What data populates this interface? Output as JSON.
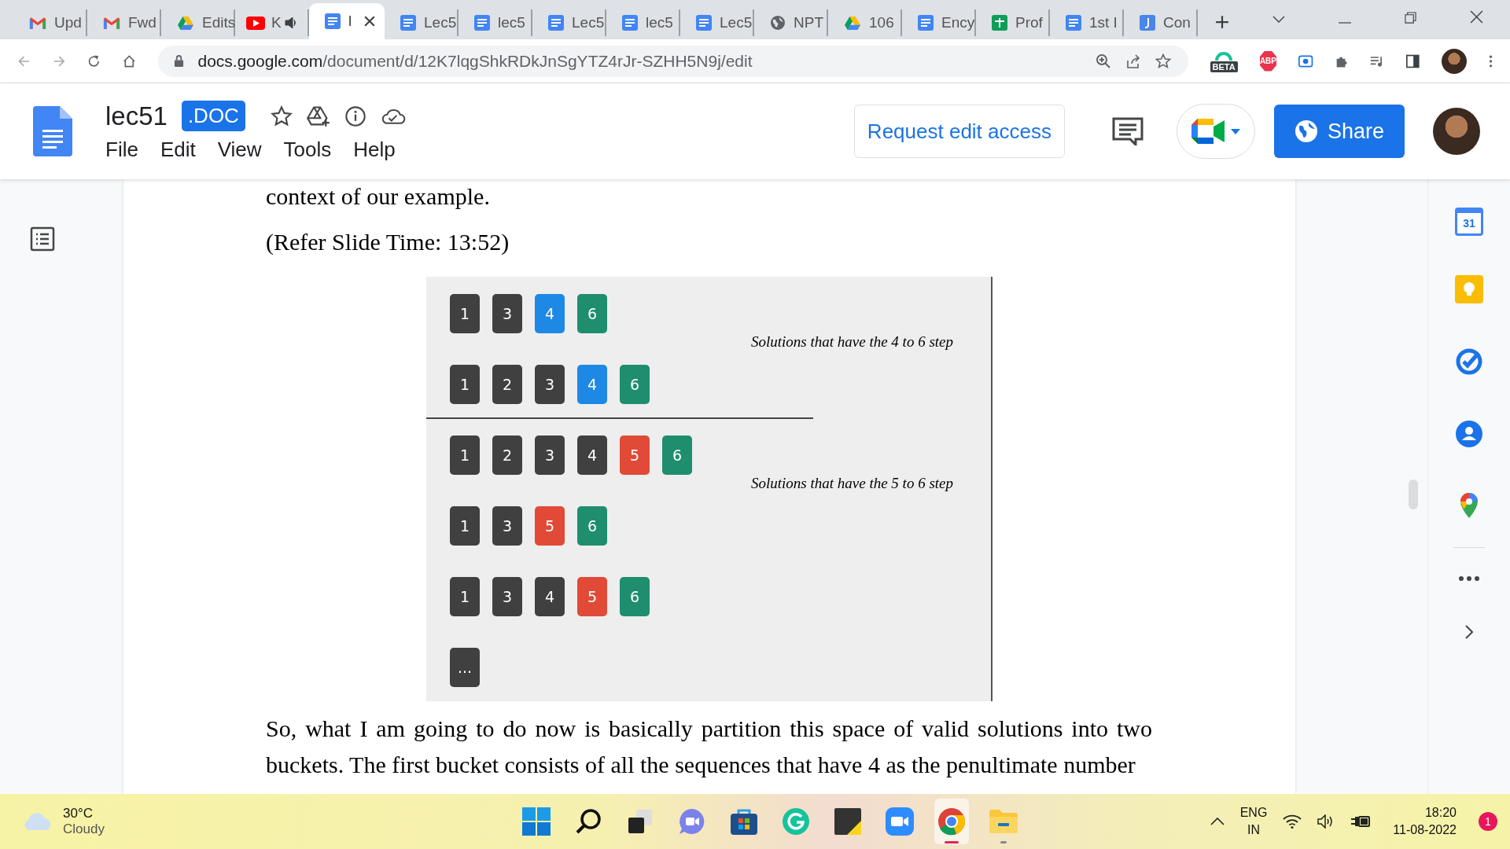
{
  "browser": {
    "tabs": [
      {
        "kind": "gmail",
        "label": "Upd",
        "selected": false,
        "audio": false
      },
      {
        "kind": "gmail",
        "label": "Fwd",
        "selected": false,
        "audio": false
      },
      {
        "kind": "drive",
        "label": "Edits",
        "selected": false,
        "audio": false
      },
      {
        "kind": "youtube",
        "label": "K",
        "selected": false,
        "audio": true
      },
      {
        "kind": "docs",
        "label": "l",
        "selected": true,
        "audio": false
      },
      {
        "kind": "docs",
        "label": "Lec5",
        "selected": false,
        "audio": false
      },
      {
        "kind": "docs",
        "label": "lec5",
        "selected": false,
        "audio": false
      },
      {
        "kind": "docs",
        "label": "Lec5",
        "selected": false,
        "audio": false
      },
      {
        "kind": "docs",
        "label": "lec5",
        "selected": false,
        "audio": false
      },
      {
        "kind": "docs",
        "label": "Lec5",
        "selected": false,
        "audio": false
      },
      {
        "kind": "web",
        "label": "NPT",
        "selected": false,
        "audio": false
      },
      {
        "kind": "drive",
        "label": "106",
        "selected": false,
        "audio": false
      },
      {
        "kind": "docs",
        "label": "Ency",
        "selected": false,
        "audio": false
      },
      {
        "kind": "sheets",
        "label": "Prof",
        "selected": false,
        "audio": false
      },
      {
        "kind": "docs",
        "label": "1st I",
        "selected": false,
        "audio": false
      },
      {
        "kind": "bluedoc",
        "label": "Con",
        "selected": false,
        "audio": false
      }
    ],
    "url": "docs.google.com/document/d/12K7lqgShkRDkJnSgYTZ4rJr-SZHH5N9j/edit",
    "beta_badge": "BETA",
    "abp_badge": "ABP"
  },
  "docs": {
    "title": "lec51",
    "file_badge": ".DOC",
    "menu": [
      "File",
      "Edit",
      "View",
      "Tools",
      "Help"
    ],
    "request_button": "Request edit access",
    "share_button": "Share"
  },
  "document": {
    "top_line": "context of our example.",
    "caption": "(Refer Slide Time: 13:52)",
    "slide": {
      "groups": [
        {
          "label": "Solutions that have the 4 to 6 step",
          "rows": [
            [
              {
                "label": "1",
                "color": "#404040"
              },
              {
                "label": "3",
                "color": "#404040"
              },
              {
                "label": "4",
                "color": "#1e88e5"
              },
              {
                "label": "6",
                "color": "#1e8e6e"
              }
            ],
            [
              {
                "label": "1",
                "color": "#404040"
              },
              {
                "label": "2",
                "color": "#404040"
              },
              {
                "label": "3",
                "color": "#404040"
              },
              {
                "label": "4",
                "color": "#1e88e5"
              },
              {
                "label": "6",
                "color": "#1e8e6e"
              }
            ]
          ]
        },
        {
          "label": "Solutions that have the 5 to 6 step",
          "rows": [
            [
              {
                "label": "1",
                "color": "#404040"
              },
              {
                "label": "2",
                "color": "#404040"
              },
              {
                "label": "3",
                "color": "#404040"
              },
              {
                "label": "4",
                "color": "#404040"
              },
              {
                "label": "5",
                "color": "#e04a36"
              },
              {
                "label": "6",
                "color": "#1e8e6e"
              }
            ],
            [
              {
                "label": "1",
                "color": "#404040"
              },
              {
                "label": "3",
                "color": "#404040"
              },
              {
                "label": "5",
                "color": "#e04a36"
              },
              {
                "label": "6",
                "color": "#1e8e6e"
              }
            ],
            [
              {
                "label": "1",
                "color": "#404040"
              },
              {
                "label": "3",
                "color": "#404040"
              },
              {
                "label": "4",
                "color": "#404040"
              },
              {
                "label": "5",
                "color": "#e04a36"
              },
              {
                "label": "6",
                "color": "#1e8e6e"
              }
            ],
            [
              {
                "label": "...",
                "color": "#404040"
              }
            ]
          ]
        }
      ]
    },
    "paragraph": "So, what I am going to do now is basically partition this space of valid solutions into two buckets. The first bucket consists of all the sequences that have 4 as the penultimate number"
  },
  "side_panel": {
    "calendar_day": "31"
  },
  "taskbar": {
    "temperature": "30°C",
    "condition": "Cloudy",
    "apps": [
      {
        "kind": "start",
        "selected": false,
        "running": false
      },
      {
        "kind": "search",
        "selected": false,
        "running": false
      },
      {
        "kind": "taskview",
        "selected": false,
        "running": false
      },
      {
        "kind": "chat",
        "selected": false,
        "running": false
      },
      {
        "kind": "store",
        "selected": false,
        "running": false
      },
      {
        "kind": "grammar",
        "selected": false,
        "running": false
      },
      {
        "kind": "notes",
        "selected": false,
        "running": false
      },
      {
        "kind": "video",
        "selected": false,
        "running": false
      },
      {
        "kind": "chrome",
        "selected": true,
        "running": true
      },
      {
        "kind": "folder",
        "selected": false,
        "running": true
      }
    ],
    "language": "ENG",
    "region": "IN",
    "time": "18:20",
    "date": "11-08-2022",
    "notifications": "1"
  }
}
